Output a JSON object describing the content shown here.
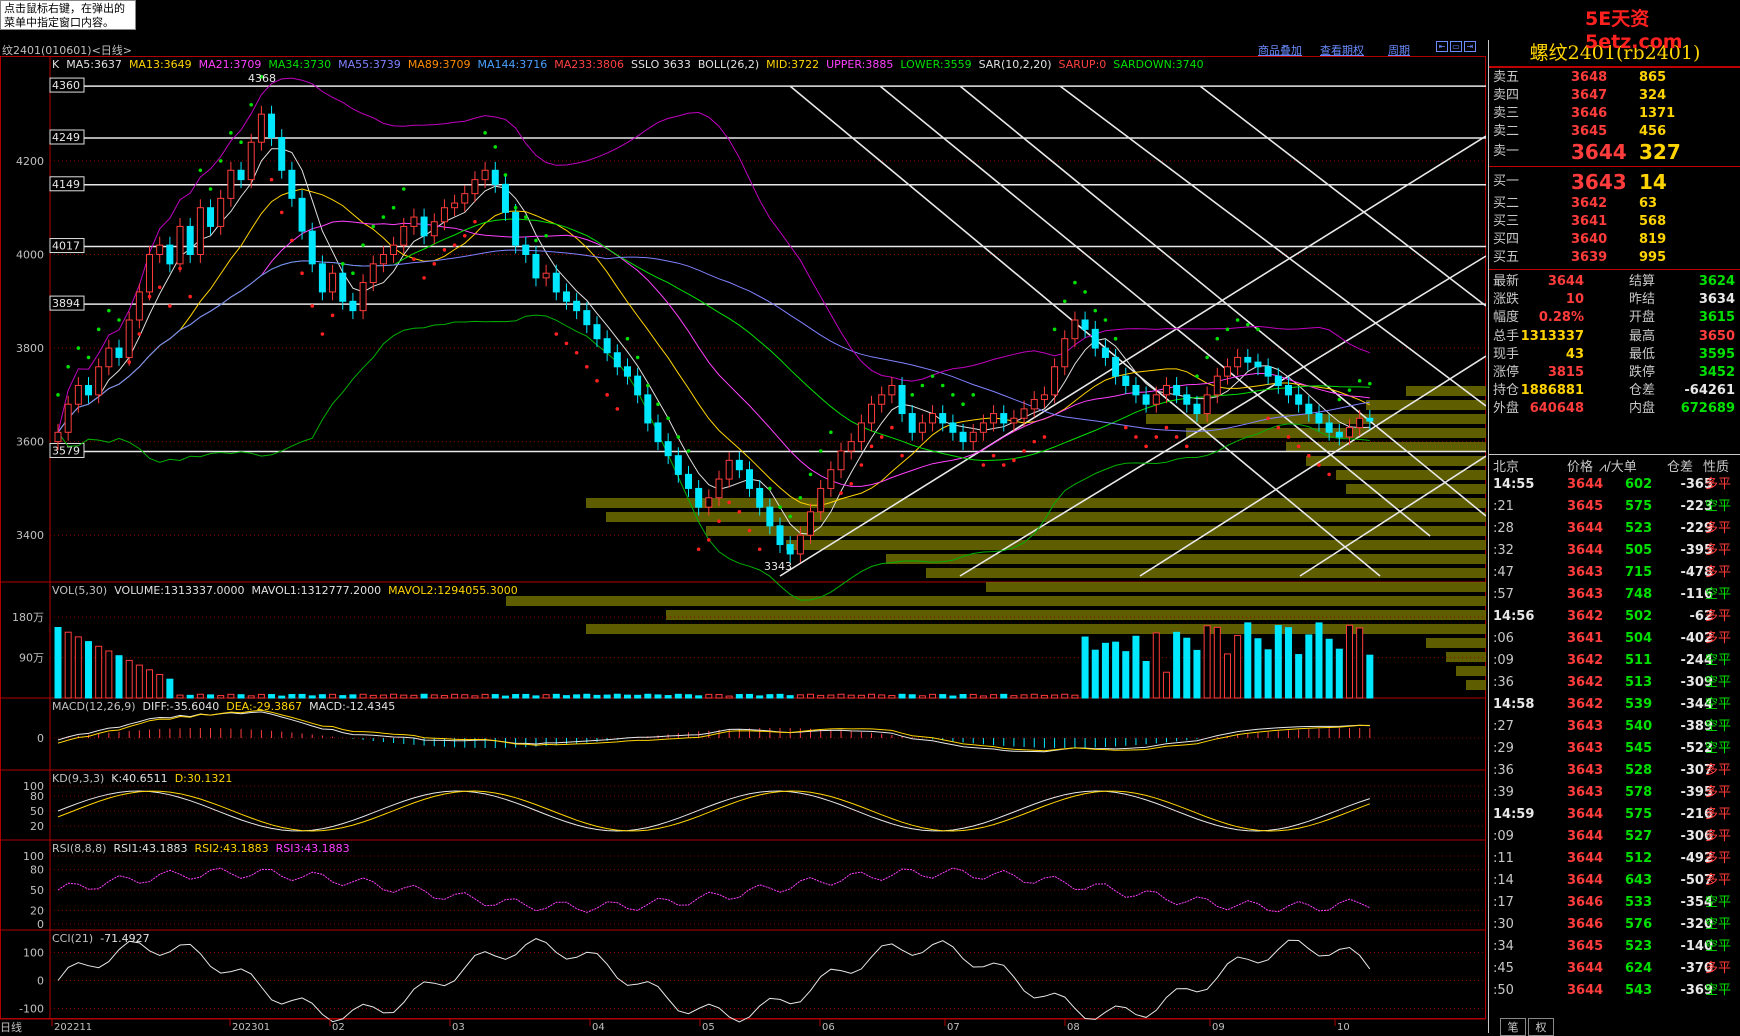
{
  "tooltip": "点击鼠标右键，在弹出的菜单中指定窗口内容。",
  "logo": "5E天资5etz.com",
  "window_title": "纹2401(010601)<日线>",
  "toolbar_links": {
    "overlay": "商品叠加",
    "options": "查看期权",
    "period": "周期"
  },
  "indicators": {
    "ma_line": [
      {
        "text": "K",
        "color": "#e0e0e0"
      },
      {
        "text": "MA5:3637",
        "color": "#e0e0e0"
      },
      {
        "text": "MA13:3649",
        "color": "#ffd400"
      },
      {
        "text": "MA21:3709",
        "color": "#ff40ff"
      },
      {
        "text": "MA34:3730",
        "color": "#00e000"
      },
      {
        "text": "MA55:3739",
        "color": "#8080ff"
      },
      {
        "text": "MA89:3709",
        "color": "#ff8c00"
      },
      {
        "text": "MA144:3716",
        "color": "#4aa0ff"
      },
      {
        "text": "MA233:3806",
        "color": "#ff4040"
      },
      {
        "text": "SSLO 3633",
        "color": "#e0e0e0"
      },
      {
        "text": "BOLL(26,2)",
        "color": "#e0e0e0"
      },
      {
        "text": "MID:3722",
        "color": "#ffd400"
      },
      {
        "text": "UPPER:3885",
        "color": "#ff40ff"
      },
      {
        "text": "LOWER:3559",
        "color": "#00e000"
      },
      {
        "text": "SAR(10,2,20)",
        "color": "#e0e0e0"
      },
      {
        "text": "SARUP:0",
        "color": "#ff4040"
      },
      {
        "text": "SARDOWN:3740",
        "color": "#00e000"
      }
    ],
    "vol_line": [
      {
        "text": "VOL(5,30)",
        "color": "#c0c0c0"
      },
      {
        "text": "VOLUME:1313337.0000",
        "color": "#e0e0e0"
      },
      {
        "text": "MAVOL1:1312777.2000",
        "color": "#e0e0e0"
      },
      {
        "text": "MAVOL2:1294055.3000",
        "color": "#ffd400"
      }
    ],
    "macd_line": [
      {
        "text": "MACD(12,26,9)",
        "color": "#c0c0c0"
      },
      {
        "text": "DIFF:-35.6040",
        "color": "#e0e0e0"
      },
      {
        "text": "DEA:-29.3867",
        "color": "#ffd400"
      },
      {
        "text": "MACD:-12.4345",
        "color": "#e0e0e0"
      }
    ],
    "kd_line": [
      {
        "text": "KD(9,3,3)",
        "color": "#c0c0c0"
      },
      {
        "text": "K:40.6511",
        "color": "#e0e0e0"
      },
      {
        "text": "D:30.1321",
        "color": "#ffd400"
      }
    ],
    "rsi_line": [
      {
        "text": "RSI(8,8,8)",
        "color": "#c0c0c0"
      },
      {
        "text": "RSI1:43.1883",
        "color": "#e0e0e0"
      },
      {
        "text": "RSI2:43.1883",
        "color": "#ffd400"
      },
      {
        "text": "RSI3:43.1883",
        "color": "#ff40ff"
      }
    ],
    "cci_line": [
      {
        "text": "CCI(21)",
        "color": "#c0c0c0"
      },
      {
        "text": "-71.4927",
        "color": "#e0e0e0"
      }
    ]
  },
  "chart_data": {
    "type": "candlestick",
    "price_ticks": [
      "4200",
      "4000",
      "3800",
      "3600",
      "3400"
    ],
    "level_labels": [
      "4360",
      "4249",
      "4149",
      "4017",
      "3894",
      "3579"
    ],
    "high_label": "4368",
    "low_label": "3343",
    "x_ticks": [
      "202211",
      "202301",
      "02",
      "03",
      "04",
      "05",
      "06",
      "07",
      "08",
      "09",
      "10"
    ],
    "x_axis_title": "日线",
    "vol_ticks": [
      "180万",
      "90万"
    ],
    "macd_ticks": [
      "0"
    ],
    "kd_ticks": [
      "100",
      "80",
      "50",
      "20"
    ],
    "kd_ticks_extra": [
      "20",
      "0"
    ],
    "rsi_ticks": [
      "100",
      "80",
      "50",
      "20",
      "0"
    ],
    "rsi_ticks_extra": [
      "20"
    ],
    "cci_ticks": [
      "100",
      "0",
      "-100"
    ],
    "closes": [
      3620,
      3680,
      3720,
      3700,
      3760,
      3800,
      3780,
      3860,
      3920,
      4000,
      4020,
      3980,
      4060,
      4000,
      4100,
      4060,
      4120,
      4180,
      4160,
      4240,
      4300,
      4250,
      4180,
      4120,
      4050,
      3980,
      3920,
      3960,
      3900,
      3880,
      3940,
      3980,
      4000,
      4020,
      4060,
      4080,
      4040,
      4070,
      4100,
      4110,
      4130,
      4160,
      4180,
      4150,
      4090,
      4020,
      4000,
      3950,
      3960,
      3920,
      3900,
      3880,
      3850,
      3820,
      3790,
      3760,
      3740,
      3700,
      3640,
      3600,
      3570,
      3530,
      3500,
      3460,
      3480,
      3520,
      3560,
      3540,
      3500,
      3460,
      3420,
      3380,
      3360,
      3400,
      3450,
      3500,
      3540,
      3580,
      3600,
      3640,
      3680,
      3700,
      3720,
      3660,
      3620,
      3640,
      3660,
      3640,
      3620,
      3600,
      3620,
      3640,
      3660,
      3640,
      3650,
      3670,
      3690,
      3700,
      3760,
      3820,
      3860,
      3840,
      3800,
      3780,
      3740,
      3720,
      3700,
      3680,
      3700,
      3720,
      3700,
      3680,
      3660,
      3700,
      3740,
      3760,
      3780,
      3770,
      3760,
      3740,
      3720,
      3700,
      3680,
      3660,
      3640,
      3620,
      3610,
      3630,
      3650,
      3644
    ]
  },
  "quote": {
    "symbol": "螺纹2401(rb2401)",
    "asks": [
      {
        "label": "卖五",
        "price": "3648",
        "vol": "865"
      },
      {
        "label": "卖四",
        "price": "3647",
        "vol": "324"
      },
      {
        "label": "卖三",
        "price": "3646",
        "vol": "1371"
      },
      {
        "label": "卖二",
        "price": "3645",
        "vol": "456"
      },
      {
        "label": "卖一",
        "price": "3644",
        "vol": "327"
      }
    ],
    "bids": [
      {
        "label": "买一",
        "price": "3643",
        "vol": "14"
      },
      {
        "label": "买二",
        "price": "3642",
        "vol": "63"
      },
      {
        "label": "买三",
        "price": "3641",
        "vol": "568"
      },
      {
        "label": "买四",
        "price": "3640",
        "vol": "819"
      },
      {
        "label": "买五",
        "price": "3639",
        "vol": "995"
      }
    ],
    "stats": [
      {
        "k": "最新",
        "v": "3644",
        "vc": "#ff3c3c",
        "k2": "结算",
        "v2": "3624",
        "v2c": "#00e000"
      },
      {
        "k": "涨跌",
        "v": "10",
        "vc": "#ff3c3c",
        "k2": "昨结",
        "v2": "3634",
        "v2c": "#e8e8e8"
      },
      {
        "k": "幅度",
        "v": "0.28%",
        "vc": "#ff3c3c",
        "k2": "开盘",
        "v2": "3615",
        "v2c": "#00e000"
      },
      {
        "k": "总手",
        "v": "1313337",
        "vc": "#ffd400",
        "k2": "最高",
        "v2": "3650",
        "v2c": "#ff3c3c"
      },
      {
        "k": "现手",
        "v": "43",
        "vc": "#ffd400",
        "k2": "最低",
        "v2": "3595",
        "v2c": "#00e000"
      },
      {
        "k": "涨停",
        "v": "3815",
        "vc": "#ff3c3c",
        "k2": "跌停",
        "v2": "3452",
        "v2c": "#00e000"
      },
      {
        "k": "持仓",
        "v": "1886881",
        "vc": "#ffd400",
        "k2": "仓差",
        "v2": "-64261",
        "v2c": "#e8e8e8"
      },
      {
        "k": "外盘",
        "v": "640648",
        "vc": "#ff3c3c",
        "k2": "内盘",
        "v2": "672689",
        "v2c": "#00e000"
      }
    ],
    "tick_header": {
      "time": "北京",
      "price": "价格",
      "size": "⩘/大单",
      "oi": "仓差",
      "nature": "性质"
    },
    "ticks": [
      {
        "t": "14:55",
        "bold": true,
        "p": "3644",
        "s": "602",
        "oi": "-365",
        "n": "多平",
        "g": false
      },
      {
        "t": ":21",
        "bold": false,
        "p": "3645",
        "s": "575",
        "oi": "-223",
        "n": "空平",
        "g": true
      },
      {
        "t": ":28",
        "bold": false,
        "p": "3644",
        "s": "523",
        "oi": "-229",
        "n": "多平",
        "g": false
      },
      {
        "t": ":32",
        "bold": false,
        "p": "3644",
        "s": "505",
        "oi": "-395",
        "n": "多平",
        "g": false
      },
      {
        "t": ":47",
        "bold": false,
        "p": "3643",
        "s": "715",
        "oi": "-478",
        "n": "多平",
        "g": false
      },
      {
        "t": ":57",
        "bold": false,
        "p": "3643",
        "s": "748",
        "oi": "-116",
        "n": "空平",
        "g": true
      },
      {
        "t": "14:56",
        "bold": true,
        "p": "3642",
        "s": "502",
        "oi": "-62",
        "n": "多平",
        "g": false
      },
      {
        "t": ":06",
        "bold": false,
        "p": "3641",
        "s": "504",
        "oi": "-402",
        "n": "多平",
        "g": false
      },
      {
        "t": ":09",
        "bold": false,
        "p": "3642",
        "s": "511",
        "oi": "-244",
        "n": "空平",
        "g": true
      },
      {
        "t": ":36",
        "bold": false,
        "p": "3642",
        "s": "513",
        "oi": "-309",
        "n": "空平",
        "g": true
      },
      {
        "t": "14:58",
        "bold": true,
        "p": "3642",
        "s": "539",
        "oi": "-344",
        "n": "空平",
        "g": true
      },
      {
        "t": ":27",
        "bold": false,
        "p": "3643",
        "s": "540",
        "oi": "-389",
        "n": "空平",
        "g": true
      },
      {
        "t": ":29",
        "bold": false,
        "p": "3643",
        "s": "545",
        "oi": "-522",
        "n": "空平",
        "g": true
      },
      {
        "t": ":36",
        "bold": false,
        "p": "3643",
        "s": "528",
        "oi": "-307",
        "n": "多平",
        "g": false
      },
      {
        "t": ":39",
        "bold": false,
        "p": "3643",
        "s": "578",
        "oi": "-395",
        "n": "多平",
        "g": false
      },
      {
        "t": "14:59",
        "bold": true,
        "p": "3644",
        "s": "575",
        "oi": "-216",
        "n": "多平",
        "g": false
      },
      {
        "t": ":09",
        "bold": false,
        "p": "3644",
        "s": "527",
        "oi": "-306",
        "n": "多平",
        "g": false
      },
      {
        "t": ":11",
        "bold": false,
        "p": "3644",
        "s": "512",
        "oi": "-492",
        "n": "多平",
        "g": false
      },
      {
        "t": ":14",
        "bold": false,
        "p": "3644",
        "s": "643",
        "oi": "-507",
        "n": "多平",
        "g": false
      },
      {
        "t": ":17",
        "bold": false,
        "p": "3646",
        "s": "533",
        "oi": "-354",
        "n": "空平",
        "g": true
      },
      {
        "t": ":30",
        "bold": false,
        "p": "3646",
        "s": "576",
        "oi": "-320",
        "n": "空平",
        "g": true
      },
      {
        "t": ":34",
        "bold": false,
        "p": "3645",
        "s": "523",
        "oi": "-140",
        "n": "空平",
        "g": true
      },
      {
        "t": ":45",
        "bold": false,
        "p": "3644",
        "s": "624",
        "oi": "-370",
        "n": "多平",
        "g": false
      },
      {
        "t": ":50",
        "bold": false,
        "p": "3644",
        "s": "543",
        "oi": "-369",
        "n": "空平",
        "g": true
      }
    ],
    "bottom_tabs": [
      "笔",
      "权"
    ]
  }
}
